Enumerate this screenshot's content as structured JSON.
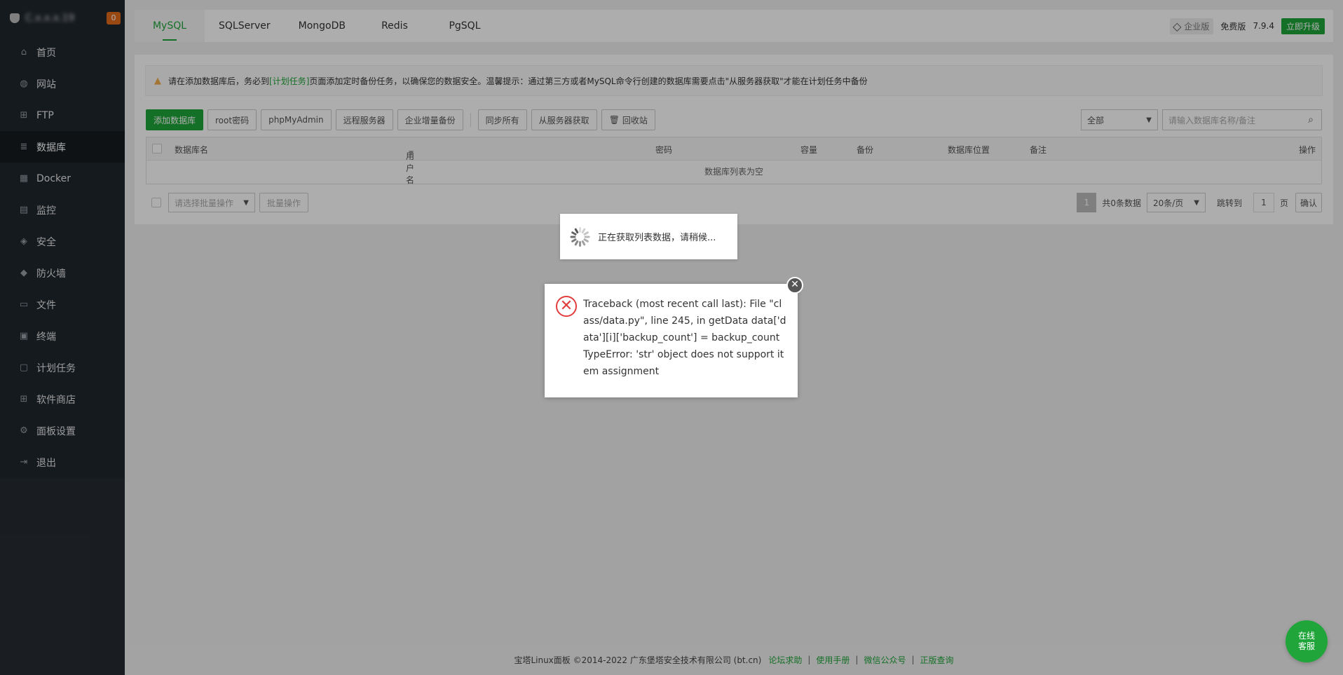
{
  "sidebar": {
    "server_ip": "C.x.x.x.19",
    "alert_count": "0",
    "items": [
      {
        "label": "首页",
        "icon": "home-icon"
      },
      {
        "label": "网站",
        "icon": "globe-icon"
      },
      {
        "label": "FTP",
        "icon": "ftp-icon"
      },
      {
        "label": "数据库",
        "icon": "database-icon"
      },
      {
        "label": "Docker",
        "icon": "docker-icon"
      },
      {
        "label": "监控",
        "icon": "monitor-icon"
      },
      {
        "label": "安全",
        "icon": "shield-icon"
      },
      {
        "label": "防火墙",
        "icon": "firewall-icon"
      },
      {
        "label": "文件",
        "icon": "folder-icon"
      },
      {
        "label": "终端",
        "icon": "terminal-icon"
      },
      {
        "label": "计划任务",
        "icon": "calendar-icon"
      },
      {
        "label": "软件商店",
        "icon": "grid-icon"
      },
      {
        "label": "面板设置",
        "icon": "gear-icon"
      },
      {
        "label": "退出",
        "icon": "logout-icon"
      }
    ],
    "active_index": 3
  },
  "tabs": [
    "MySQL",
    "SQLServer",
    "MongoDB",
    "Redis",
    "PgSQL"
  ],
  "header": {
    "enterprise_label": "企业版",
    "free_label": "免费版",
    "version": "7.9.4",
    "upgrade_label": "立即升级"
  },
  "notice": {
    "text_before": "请在添加数据库后，务必到",
    "link": "[计划任务]",
    "text_after": "页面添加定时备份任务，以确保您的数据安全。温馨提示：通过第三方或者MySQL命令行创建的数据库需要点击\"从服务器获取\"才能在计划任务中备份"
  },
  "toolbar": {
    "add_db": "添加数据库",
    "root_pwd": "root密码",
    "phpmyadmin": "phpMyAdmin",
    "remote": "远程服务器",
    "incremental": "企业增量备份",
    "sync_all": "同步所有",
    "fetch": "从服务器获取",
    "recycle": "回收站",
    "filter": "全部",
    "search_placeholder": "请输入数据库名称/备注"
  },
  "table": {
    "columns": [
      "数据库名",
      "用户名",
      "密码",
      "容量",
      "备份",
      "数据库位置",
      "备注",
      "操作"
    ],
    "empty_text": "数据库列表为空"
  },
  "batch": {
    "select_placeholder": "请选择批量操作",
    "button": "批量操作"
  },
  "pagination": {
    "current": "1",
    "total": "共0条数据",
    "per_page": "20条/页",
    "jump_label": "跳转到",
    "jump_value": "1",
    "page_unit": "页",
    "confirm": "确认"
  },
  "footer": {
    "copyright": "宝塔Linux面板 ©2014-2022 广东堡塔安全技术有限公司 (bt.cn)",
    "links": [
      "论坛求助",
      "使用手册",
      "微信公众号",
      "正版查询"
    ]
  },
  "loading": {
    "text": "正在获取列表数据，请稍候..."
  },
  "error": {
    "message": "Traceback (most recent call last): File \"class/data.py\", line 245, in getData data['data'][i]['backup_count'] = backup_count TypeError: 'str' object does not support item assignment"
  },
  "service": {
    "line1": "在线",
    "line2": "客服"
  },
  "colors": {
    "brand_green": "#20a53a",
    "sidebar_bg": "#20272e",
    "error_red": "#e23d3d",
    "badge_orange": "#e46b1b"
  }
}
